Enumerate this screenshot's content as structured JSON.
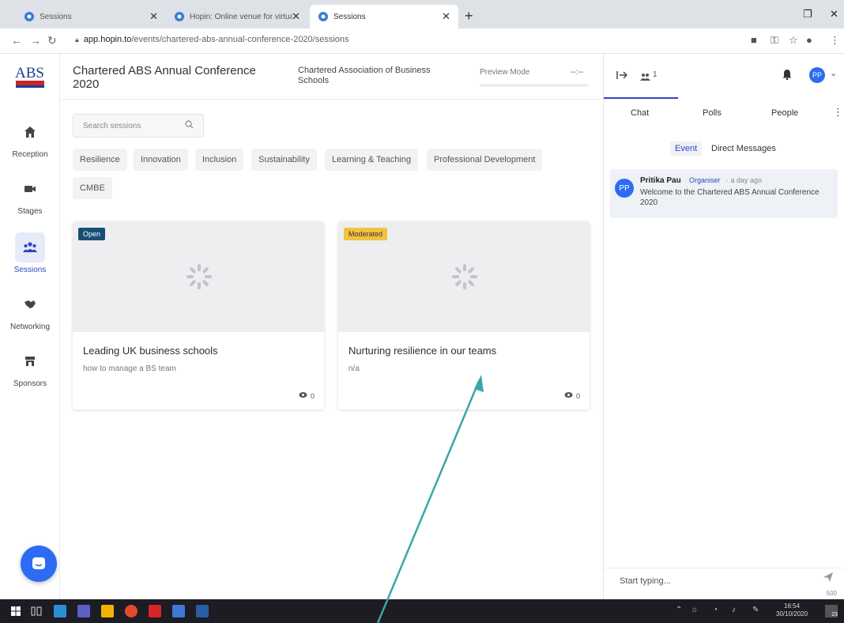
{
  "browser": {
    "tabs": [
      {
        "title": "Sessions",
        "active": false
      },
      {
        "title": "Hopin: Online venue for virtual ev",
        "active": false
      },
      {
        "title": "Sessions",
        "active": true
      }
    ],
    "url_host": "app.hopin.to",
    "url_path": "/events/chartered-abs-annual-conference-2020/sessions"
  },
  "header": {
    "event_title": "Chartered ABS Annual Conference 2020",
    "organisation": "Chartered Association of Business Schools",
    "preview_mode": "Preview Mode",
    "timer": "--:--"
  },
  "nav": {
    "items": [
      {
        "label": "Reception",
        "icon": "home-icon",
        "active": false
      },
      {
        "label": "Stages",
        "icon": "video-camera-icon",
        "active": false
      },
      {
        "label": "Sessions",
        "icon": "group-icon",
        "active": true
      },
      {
        "label": "Networking",
        "icon": "handshake-icon",
        "active": false
      },
      {
        "label": "Sponsors",
        "icon": "booth-icon",
        "active": false
      }
    ]
  },
  "main": {
    "search_placeholder": "Search sessions",
    "filters": [
      "Resilience",
      "Innovation",
      "Inclusion",
      "Sustainability",
      "Learning & Teaching",
      "Professional Development",
      "CMBE"
    ],
    "sessions": [
      {
        "badge": "Open",
        "title": "Leading UK business schools",
        "description": "how to manage a BS team",
        "views": "0"
      },
      {
        "badge": "Moderated",
        "title": "Nurturing resilience in our teams",
        "description": "n/a",
        "views": "0"
      }
    ]
  },
  "panel": {
    "attendees": "1",
    "avatar_initials": "PP",
    "tabs": [
      "Chat",
      "Polls",
      "People"
    ],
    "segments": [
      "Event",
      "Direct Messages"
    ],
    "message": {
      "initials": "PP",
      "author": "Pritika Pau",
      "role": "Organiser",
      "time": "· a day ago",
      "text": "Welcome to the Chartered ABS Annual Conference 2020"
    },
    "composer_placeholder": "Start typing...",
    "char_limit": "500"
  },
  "taskbar": {
    "time": "16:54",
    "date": "30/10/2020",
    "notifications": "23"
  },
  "colors": {
    "accent": "#2f45c5",
    "open_badge": "#174f73",
    "moderated_badge": "#f3c23f",
    "annotation_arrow": "#3aa6a6"
  }
}
